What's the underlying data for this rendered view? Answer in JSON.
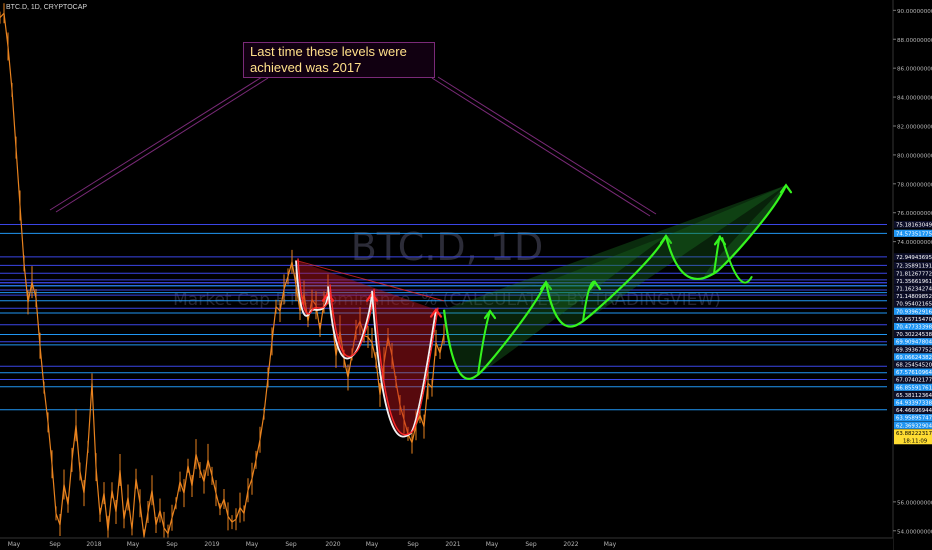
{
  "symbol_line": "BTC.D, 1D, CRYPTOCAP",
  "watermark": {
    "title": "BTC.D, 1D",
    "subtitle": "Market Cap BTC Dominance, % (CALCULATED BY TRADINGVIEW)"
  },
  "annotation": {
    "text_line1": "Last time these levels were",
    "text_line2": "achieved was 2017"
  },
  "colors": {
    "background": "#000000",
    "candles": "#e8821e",
    "level_lines": "#3b46e6",
    "level_highlight": "#2196f3",
    "callout_border": "#7a2a78",
    "callout_text": "#ffe08a",
    "bearish_fill": "#c0141c",
    "bullish_fill": "#1e7a24",
    "bullish_curve": "#35f41e",
    "bearish_arrow": "#ff2a2a",
    "price_badge": "#ffdd33"
  },
  "chart_data": {
    "type": "line",
    "x_tick_labels": [
      "May",
      "Sep",
      "2018",
      "May",
      "Sep",
      "2019",
      "May",
      "Sep",
      "2020",
      "May",
      "Sep",
      "2021",
      "May",
      "Sep",
      "2022",
      "May"
    ],
    "y_axis_ticks": [
      "90.00000000",
      "88.00000000",
      "86.00000000",
      "84.00000000",
      "82.00000000",
      "80.00000000",
      "78.00000000",
      "76.00000000",
      "74.00000000",
      "56.00000000",
      "54.00000000"
    ],
    "ylim": [
      53.5,
      90.3
    ],
    "horizontal_levels": [
      {
        "value": 75.18163049,
        "label": "75.18163049"
      },
      {
        "value": 74.57351775,
        "label": "74.57351775",
        "highlight": true
      },
      {
        "value": 72.94943695,
        "label": "72.94943695"
      },
      {
        "value": 72.35891191,
        "label": "72.35891191"
      },
      {
        "value": 71.81267772,
        "label": "71.81267772"
      },
      {
        "value": 71.35661961,
        "label": "71.35661961"
      },
      {
        "value": 71.16234274,
        "label": "71.16234274"
      },
      {
        "value": 71.14809852,
        "label": "71.14809852"
      },
      {
        "value": 70.95402165,
        "label": "70.95402165"
      },
      {
        "value": 70.93962916,
        "label": "70.93962916",
        "highlight": true
      },
      {
        "value": 70.6571547,
        "label": "70.65715470"
      },
      {
        "value": 70.47733398,
        "label": "70.47733398",
        "highlight": true
      },
      {
        "value": 70.30224538,
        "label": "70.30224538"
      },
      {
        "value": 69.90947804,
        "label": "69.90947804",
        "highlight": true
      },
      {
        "value": 69.39367752,
        "label": "69.39367752"
      },
      {
        "value": 69.06624382,
        "label": "69.06624382",
        "highlight": true
      },
      {
        "value": 68.2545452,
        "label": "68.25454520"
      },
      {
        "value": 67.57610964,
        "label": "67.57610964",
        "highlight": true
      },
      {
        "value": 67.07402177,
        "label": "67.07402177"
      },
      {
        "value": 66.85591761,
        "label": "66.85591761",
        "highlight": true
      },
      {
        "value": 65.38112364,
        "label": "65.38112364"
      },
      {
        "value": 64.93397338,
        "label": "64.93397338",
        "highlight": true
      },
      {
        "value": 64.46696944,
        "label": "64.46696944"
      },
      {
        "value": 63.95895747,
        "label": "63.95895747",
        "highlight": true
      },
      {
        "value": 62.36932904,
        "label": "62.36932904",
        "highlight": true
      }
    ],
    "current_price": {
      "value": 63.88222317,
      "label": "63.88222317",
      "countdown": "18:11:09"
    },
    "price_series": {
      "name": "BTC.D",
      "points": [
        [
          0,
          89.5
        ],
        [
          4,
          89.8
        ],
        [
          8,
          87.5
        ],
        [
          12,
          84.5
        ],
        [
          16,
          80.5
        ],
        [
          20,
          76.5
        ],
        [
          24,
          72.5
        ],
        [
          28,
          69.8
        ],
        [
          32,
          71.2
        ],
        [
          36,
          70.1
        ],
        [
          40,
          66.8
        ],
        [
          44,
          63.9
        ],
        [
          48,
          61.5
        ],
        [
          52,
          58.6
        ],
        [
          56,
          55.2
        ],
        [
          60,
          54.4
        ],
        [
          64,
          57.2
        ],
        [
          68,
          55.8
        ],
        [
          72,
          58.9
        ],
        [
          76,
          61.3
        ],
        [
          80,
          58.1
        ],
        [
          84,
          56.6
        ],
        [
          88,
          59.8
        ],
        [
          92,
          64.2
        ],
        [
          96,
          58.4
        ],
        [
          100,
          55.1
        ],
        [
          104,
          56.6
        ],
        [
          108,
          54.0
        ],
        [
          112,
          56.8
        ],
        [
          116,
          55.3
        ],
        [
          120,
          58.2
        ],
        [
          124,
          54.8
        ],
        [
          128,
          56.3
        ],
        [
          132,
          54.1
        ],
        [
          136,
          57.6
        ],
        [
          140,
          55.9
        ],
        [
          144,
          53.6
        ],
        [
          148,
          55.3
        ],
        [
          152,
          56.8
        ],
        [
          156,
          54.4
        ],
        [
          160,
          55.4
        ],
        [
          164,
          54.2
        ],
        [
          168,
          53.8
        ],
        [
          172,
          54.9
        ],
        [
          176,
          55.9
        ],
        [
          180,
          57.4
        ],
        [
          184,
          56.6
        ],
        [
          188,
          58.5
        ],
        [
          192,
          57.1
        ],
        [
          196,
          59.3
        ],
        [
          200,
          58.2
        ],
        [
          204,
          57.4
        ],
        [
          208,
          58.9
        ],
        [
          212,
          57.8
        ],
        [
          216,
          56.6
        ],
        [
          220,
          55.5
        ],
        [
          224,
          56.2
        ],
        [
          228,
          55.0
        ],
        [
          232,
          54.6
        ],
        [
          236,
          54.8
        ],
        [
          240,
          55.6
        ],
        [
          244,
          55.2
        ],
        [
          248,
          56.8
        ],
        [
          252,
          57.6
        ],
        [
          256,
          58.9
        ],
        [
          260,
          60.3
        ],
        [
          264,
          62.1
        ],
        [
          268,
          64.6
        ],
        [
          272,
          67.1
        ],
        [
          276,
          69.5
        ],
        [
          280,
          69.2
        ],
        [
          284,
          70.7
        ],
        [
          288,
          71.6
        ],
        [
          292,
          72.6
        ],
        [
          296,
          71.0
        ],
        [
          300,
          69.2
        ],
        [
          304,
          70.4
        ],
        [
          308,
          68.5
        ],
        [
          312,
          70.0
        ],
        [
          316,
          69.6
        ],
        [
          320,
          67.9
        ],
        [
          324,
          69.8
        ],
        [
          328,
          70.7
        ],
        [
          332,
          68.7
        ],
        [
          336,
          66.1
        ],
        [
          340,
          67.8
        ],
        [
          344,
          65.9
        ],
        [
          348,
          64.6
        ],
        [
          352,
          66.2
        ],
        [
          356,
          67.9
        ],
        [
          360,
          68.5
        ],
        [
          364,
          67.5
        ],
        [
          368,
          67.4
        ],
        [
          372,
          67.0
        ],
        [
          376,
          65.8
        ],
        [
          380,
          63.4
        ],
        [
          384,
          65.6
        ],
        [
          388,
          67.4
        ],
        [
          392,
          66.1
        ],
        [
          396,
          64.3
        ],
        [
          400,
          62.7
        ],
        [
          404,
          61.7
        ],
        [
          408,
          60.7
        ],
        [
          412,
          60.1
        ],
        [
          416,
          61.3
        ],
        [
          420,
          62.0
        ],
        [
          424,
          61.2
        ],
        [
          428,
          64.2
        ],
        [
          432,
          63.9
        ],
        [
          436,
          67.0
        ],
        [
          440,
          66.3
        ],
        [
          444,
          67.6
        ]
      ]
    },
    "projection_curves_bearish": [
      {
        "from": [
          296,
          72.7
        ],
        "to": [
          328,
          70.4
        ],
        "low": [
          311,
          69.2
        ]
      },
      {
        "from": [
          328,
          70.9
        ],
        "to": [
          372,
          70.4
        ],
        "low": [
          354,
          66.2
        ]
      },
      {
        "from": [
          372,
          70.6
        ],
        "to": [
          436,
          69.3
        ],
        "low": [
          410,
          60.7
        ]
      }
    ],
    "projection_curves_bullish": [
      {
        "from": [
          444,
          69.3
        ],
        "to": [
          546,
          71.2
        ],
        "low": [
          478,
          64.8
        ]
      },
      {
        "from": [
          546,
          71.2
        ],
        "to": [
          666,
          74.4
        ],
        "low": [
          583,
          68.5
        ]
      },
      {
        "from": [
          666,
          74.4
        ],
        "to": [
          786,
          77.9
        ],
        "low": [
          714,
          71.8
        ]
      }
    ]
  }
}
